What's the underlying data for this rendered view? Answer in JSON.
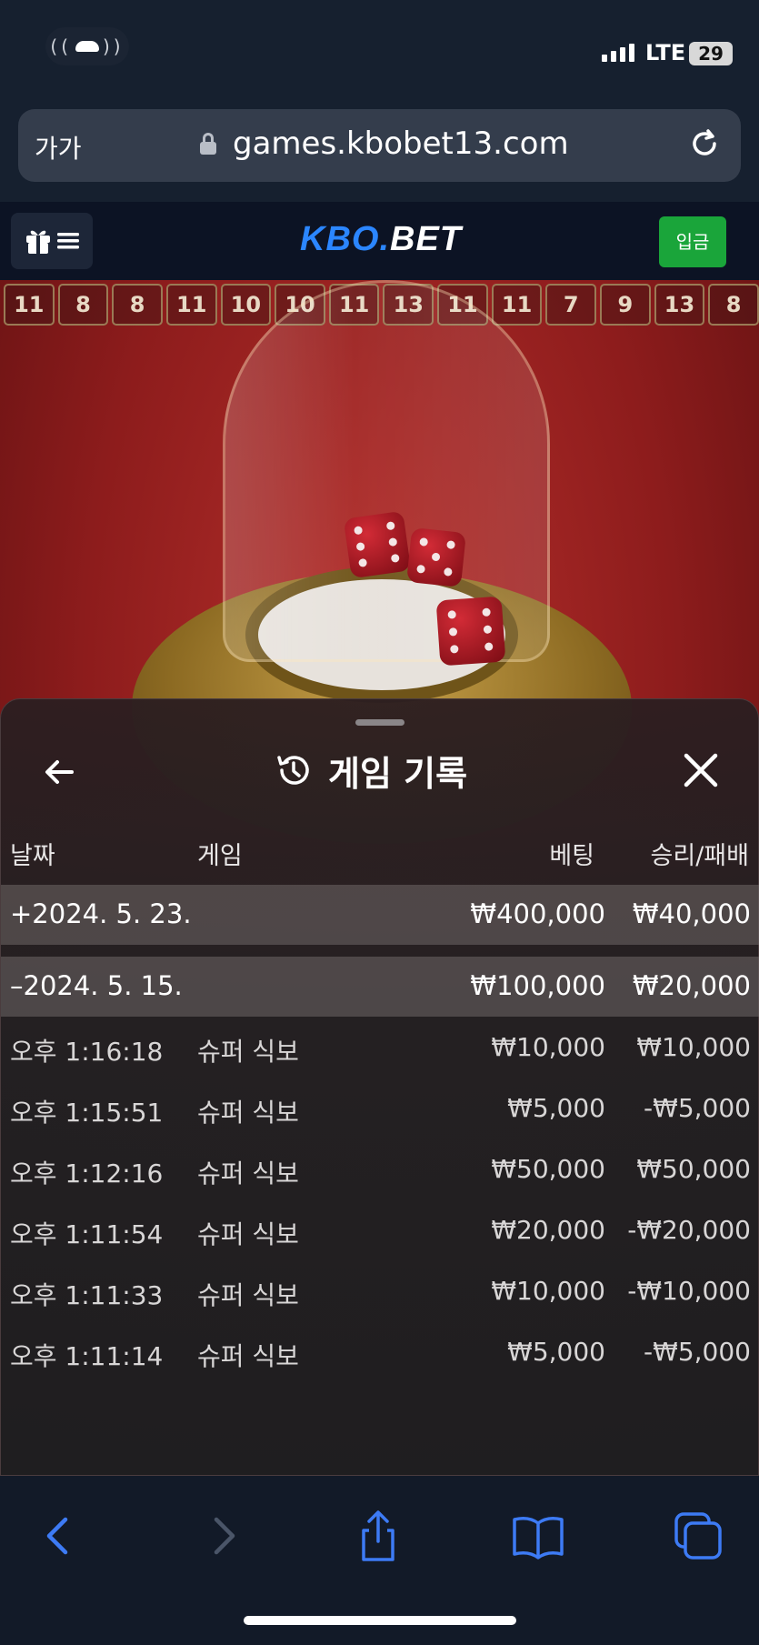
{
  "status_bar": {
    "call_label": "( ( ) )",
    "network": "LTE",
    "battery": "29",
    "signal_bars": 4
  },
  "browser": {
    "text_size_label": "가가",
    "url": "games.kbobet13.com"
  },
  "site_header": {
    "logo_kbo": "KBO",
    "logo_dot": ".",
    "logo_bet": "BET",
    "deposit_label": "입금"
  },
  "dice_history": [
    "11",
    "8",
    "8",
    "11",
    "10",
    "10",
    "11",
    "13",
    "11",
    "11",
    "7",
    "9",
    "13",
    "8"
  ],
  "sheet": {
    "title": "게임 기록",
    "columns": {
      "date": "날짜",
      "game": "게임",
      "bet": "베팅",
      "result": "승리/패배"
    },
    "summary_rows": [
      {
        "date": "+2024. 5. 23.",
        "bet": "₩400,000",
        "result": "₩40,000"
      },
      {
        "date": "–2024. 5. 15.",
        "bet": "₩100,000",
        "result": "₩20,000"
      }
    ],
    "detail_rows": [
      {
        "time": "오후 1:16:18",
        "game": "슈퍼 식보",
        "bet": "₩10,000",
        "result": "₩10,000"
      },
      {
        "time": "오후 1:15:51",
        "game": "슈퍼 식보",
        "bet": "₩5,000",
        "result": "-₩5,000"
      },
      {
        "time": "오후 1:12:16",
        "game": "슈퍼 식보",
        "bet": "₩50,000",
        "result": "₩50,000"
      },
      {
        "time": "오후 1:11:54",
        "game": "슈퍼 식보",
        "bet": "₩20,000",
        "result": "-₩20,000"
      },
      {
        "time": "오후 1:11:33",
        "game": "슈퍼 식보",
        "bet": "₩10,000",
        "result": "-₩10,000"
      },
      {
        "time": "오후 1:11:14",
        "game": "슈퍼 식보",
        "bet": "₩5,000",
        "result": "-₩5,000"
      }
    ]
  },
  "colors": {
    "accent_blue": "#2b86ff",
    "deposit_green": "#1aa53a",
    "toolbar_blue": "#3d7bf5"
  }
}
